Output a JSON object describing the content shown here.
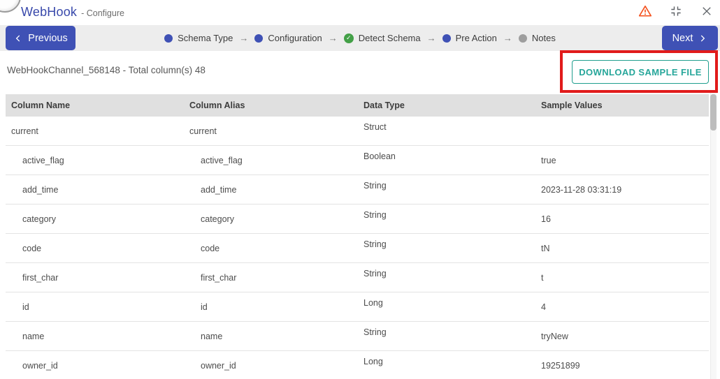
{
  "window": {
    "title": "WebHook",
    "subtitle": "- Configure",
    "icons": [
      {
        "name": "warning-triangle-icon",
        "color": "#f4511e"
      },
      {
        "name": "compress-icon",
        "color": "#5f6368"
      },
      {
        "name": "close-icon",
        "color": "#5f6368"
      }
    ]
  },
  "wizard": {
    "previous_label": "Previous",
    "next_label": "Next",
    "separator": "→",
    "steps": [
      {
        "label": "Schema Type",
        "state": "active"
      },
      {
        "label": "Configuration",
        "state": "active"
      },
      {
        "label": "Detect Schema",
        "state": "done"
      },
      {
        "label": "Pre Action",
        "state": "active"
      },
      {
        "label": "Notes",
        "state": "inactive"
      }
    ]
  },
  "content": {
    "summary": "WebHookChannel_568148 - Total column(s) 48",
    "download_button_label": "DOWNLOAD SAMPLE FILE",
    "annotation": {
      "type": "highlight-box",
      "color": "#e11b1b"
    }
  },
  "table": {
    "columns": [
      "Column Name",
      "Column Alias",
      "Data Type",
      "Sample Values"
    ],
    "rows": [
      {
        "name": "current",
        "alias": "current",
        "type": "Struct",
        "sample": "",
        "child": false
      },
      {
        "name": "active_flag",
        "alias": "active_flag",
        "type": "Boolean",
        "sample": "true",
        "child": true
      },
      {
        "name": "add_time",
        "alias": "add_time",
        "type": "String",
        "sample": "2023-11-28 03:31:19",
        "child": true
      },
      {
        "name": "category",
        "alias": "category",
        "type": "String",
        "sample": "16",
        "child": true
      },
      {
        "name": "code",
        "alias": "code",
        "type": "String",
        "sample": "tN",
        "child": true
      },
      {
        "name": "first_char",
        "alias": "first_char",
        "type": "String",
        "sample": "t",
        "child": true
      },
      {
        "name": "id",
        "alias": "id",
        "type": "Long",
        "sample": "4",
        "child": true
      },
      {
        "name": "name",
        "alias": "name",
        "type": "String",
        "sample": "tryNew",
        "child": true
      },
      {
        "name": "owner_id",
        "alias": "owner_id",
        "type": "Long",
        "sample": "19251899",
        "child": true
      }
    ]
  },
  "colors": {
    "accent_indigo": "#3f51b5",
    "teal": "#26a69a",
    "annotation_red": "#e11b1b",
    "done_green": "#43a047",
    "inactive_gray": "#9e9e9e",
    "stepbar_bg": "#ededed",
    "table_header_bg": "#e0e0e0"
  }
}
